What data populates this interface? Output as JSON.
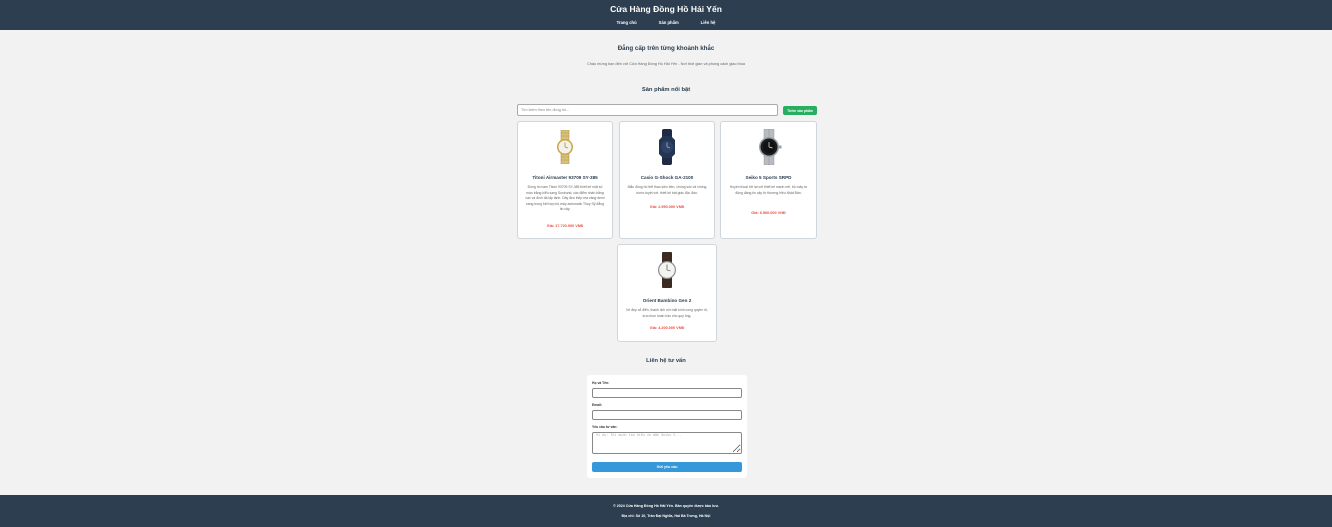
{
  "header": {
    "brand": "Cửa Hàng Đồng Hồ Hải Yến",
    "nav": [
      "Trang chủ",
      "Sản phẩm",
      "Liên hệ"
    ]
  },
  "hero": {
    "title": "Đẳng cấp trên từng khoảnh khắc",
    "subtitle": "Chào mừng bạn đến với Cửa Hàng Đồng Hồ Hải Yến - Nơi thời gian và phong cách giao thoa"
  },
  "products_section": {
    "title": "Sản phẩm nổi bật",
    "search_placeholder": "Tìm kiếm theo tên đồng hồ...",
    "add_button": "Thêm sản phẩm"
  },
  "products": [
    {
      "name": "Titoni Airmaster 93709 SY-385",
      "desc": "Đồng hồ nam Titoni 93709 SY-385 thiết kế mặt số màu trắng kiểu sang Sunburst, các điểm nhấn bằng vạc và đính đá lấp lánh. Dây đeo thép mạ vàng demi sang trọng kết hợp bộ máy automatic Thụy Sỹ đẳng tin cậy.",
      "price": "Giá: 17.720.000 VNĐ",
      "image_icon": "gold-watch-icon"
    },
    {
      "name": "Casio G-Shock GA-2100",
      "desc": "Mẫu đồng hồ thể thao siêu bền, chống sốc và chống nước tuyệt vời, thiết kế bát giác độc đáo.",
      "price": "Giá: 2.950.000 VNĐ",
      "image_icon": "navy-sport-watch-icon"
    },
    {
      "name": "Seiko 5 Sports SRPD",
      "desc": "Huyền thoại trở lại với thiết kế mạnh mẽ, bộ máy tự động đáng tin cậy từ thương hiệu Nhật Bản.",
      "price": "Giá: 6.500.000 VNĐ",
      "image_icon": "steel-diver-watch-icon"
    },
    {
      "name": "Orient Bambino Gen 2",
      "desc": "Vẻ đẹp cổ điển, thanh lịch với mặt kính cong quyền rũ, lựa chọn hoàn hảo cho quý ông.",
      "price": "Giá: 4.200.000 VNĐ",
      "image_icon": "leather-dress-watch-icon"
    }
  ],
  "contact": {
    "title": "Liên hệ tư vấn",
    "name_label": "Họ và Tên:",
    "email_label": "Email:",
    "request_label": "Yêu cầu tư vấn:",
    "request_placeholder": "Ví dụ: Tôi muốn tìm hiểu về mẫu Seiko 5...",
    "submit_label": "Gửi yêu cầu"
  },
  "footer": {
    "copyright": "© 2024 Cửa Hàng Đồng Hồ Hải Yến. Bản quyền được bảo lưu.",
    "address": "Địa chỉ: Số 10, Trần Đại Nghĩa, Hai Bà Trưng, Hà Nội"
  },
  "colors": {
    "header_bg": "#2c3e50",
    "price": "#e74c3c",
    "add_button": "#27ae60",
    "submit_button": "#3498db"
  }
}
